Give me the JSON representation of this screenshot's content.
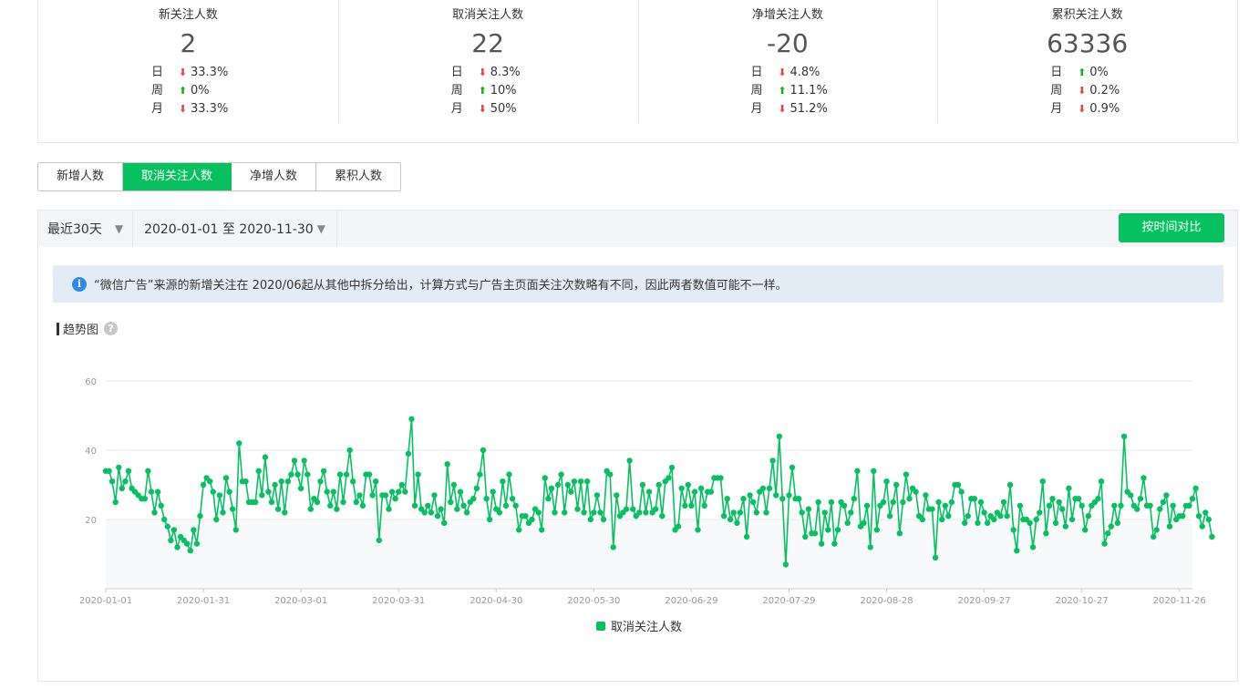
{
  "stats": [
    {
      "title": "新关注人数",
      "value": "2",
      "rows": [
        {
          "label": "日",
          "dir": "down",
          "value": "33.3%"
        },
        {
          "label": "周",
          "dir": "up",
          "value": "0%"
        },
        {
          "label": "月",
          "dir": "down",
          "value": "33.3%"
        }
      ]
    },
    {
      "title": "取消关注人数",
      "value": "22",
      "rows": [
        {
          "label": "日",
          "dir": "down",
          "value": "8.3%"
        },
        {
          "label": "周",
          "dir": "up",
          "value": "10%"
        },
        {
          "label": "月",
          "dir": "down",
          "value": "50%"
        }
      ]
    },
    {
      "title": "净增关注人数",
      "value": "-20",
      "rows": [
        {
          "label": "日",
          "dir": "down",
          "value": "4.8%"
        },
        {
          "label": "周",
          "dir": "up",
          "value": "11.1%"
        },
        {
          "label": "月",
          "dir": "down",
          "value": "51.2%"
        }
      ]
    },
    {
      "title": "累积关注人数",
      "value": "63336",
      "rows": [
        {
          "label": "日",
          "dir": "up",
          "value": "0%"
        },
        {
          "label": "周",
          "dir": "down",
          "value": "0.2%"
        },
        {
          "label": "月",
          "dir": "down",
          "value": "0.9%"
        }
      ]
    }
  ],
  "tabs": [
    {
      "label": "新增人数",
      "active": false
    },
    {
      "label": "取消关注人数",
      "active": true
    },
    {
      "label": "净增人数",
      "active": false
    },
    {
      "label": "累积人数",
      "active": false
    }
  ],
  "toolbar": {
    "range_label": "最近30天",
    "date_range": "2020-01-01 至 2020-11-30",
    "compare_button": "按时间对比"
  },
  "notice": {
    "icon": "info-icon",
    "text": "“微信广告”来源的新增关注在 2020/06起从其他中拆分给出，计算方式与广告主页面关注次数略有不同，因此两者数值可能不一样。"
  },
  "section_title": "趋势图",
  "colors": {
    "accent": "#07c160",
    "up": "#1aad19",
    "down": "#e64340"
  },
  "chart_data": {
    "type": "line",
    "x_start": "2020-01-01",
    "x_end": "2020-11-30",
    "x_ticks": [
      "2020-01-01",
      "2020-01-31",
      "2020-03-01",
      "2020-03-31",
      "2020-04-30",
      "2020-05-30",
      "2020-06-29",
      "2020-07-29",
      "2020-08-28",
      "2020-09-27",
      "2020-10-27",
      "2020-11-26"
    ],
    "y_ticks": [
      20,
      40,
      60
    ],
    "ylim": [
      0,
      60
    ],
    "grid": true,
    "legend": "bottom-center",
    "series": [
      {
        "name": "取消关注人数",
        "color": "#07c160",
        "values": [
          34,
          34,
          31,
          25,
          35,
          29,
          31,
          34,
          29,
          28,
          27,
          26,
          26,
          34,
          28,
          22,
          28,
          24,
          20,
          18,
          14,
          17,
          12,
          15,
          14,
          13,
          11,
          17,
          13,
          21,
          30,
          32,
          31,
          28,
          20,
          27,
          22,
          32,
          28,
          23,
          17,
          42,
          31,
          31,
          25,
          25,
          25,
          34,
          27,
          38,
          28,
          25,
          30,
          23,
          31,
          22,
          31,
          33,
          37,
          33,
          29,
          37,
          33,
          23,
          26,
          25,
          31,
          34,
          28,
          24,
          28,
          23,
          33,
          25,
          33,
          40,
          31,
          25,
          27,
          24,
          33,
          33,
          27,
          31,
          14,
          27,
          27,
          23,
          28,
          26,
          28,
          30,
          28,
          39,
          49,
          24,
          33,
          23,
          22,
          24,
          22,
          27,
          21,
          23,
          19,
          36,
          25,
          30,
          23,
          28,
          24,
          22,
          25,
          26,
          29,
          33,
          40,
          26,
          20,
          28,
          23,
          22,
          31,
          24,
          33,
          26,
          24,
          17,
          21,
          21,
          19,
          20,
          23,
          22,
          17,
          32,
          26,
          29,
          22,
          30,
          33,
          22,
          30,
          28,
          31,
          23,
          31,
          22,
          31,
          20,
          22,
          27,
          22,
          20,
          34,
          33,
          12,
          27,
          21,
          22,
          23,
          37,
          23,
          21,
          22,
          30,
          22,
          28,
          22,
          23,
          30,
          21,
          31,
          32,
          35,
          17,
          18,
          29,
          24,
          30,
          24,
          28,
          17,
          29,
          24,
          28,
          28,
          32,
          32,
          32,
          21,
          26,
          20,
          22,
          19,
          22,
          26,
          15,
          27,
          25,
          22,
          28,
          29,
          22,
          29,
          37,
          27,
          44,
          26,
          7,
          27,
          35,
          26,
          26,
          22,
          15,
          23,
          16,
          16,
          25,
          13,
          22,
          17,
          25,
          13,
          17,
          25,
          24,
          19,
          22,
          26,
          34,
          18,
          19,
          24,
          12,
          34,
          17,
          24,
          25,
          31,
          21,
          25,
          30,
          16,
          25,
          33,
          26,
          29,
          28,
          21,
          20,
          27,
          23,
          23,
          9,
          25,
          20,
          24,
          21,
          25,
          30,
          30,
          28,
          19,
          21,
          26,
          26,
          19,
          25,
          22,
          19,
          21,
          20,
          22,
          21,
          25,
          21,
          30,
          17,
          11,
          24,
          20,
          20,
          19,
          12,
          20,
          22,
          31,
          16,
          24,
          26,
          19,
          25,
          23,
          18,
          29,
          20,
          26,
          26,
          24,
          17,
          21,
          24,
          25,
          26,
          31,
          13,
          16,
          18,
          24,
          19,
          24,
          44,
          28,
          27,
          24,
          23,
          26,
          32,
          24,
          24,
          15,
          17,
          23,
          25,
          27,
          18,
          24,
          20,
          21,
          21,
          24,
          24,
          26,
          29,
          21,
          18,
          22,
          20,
          15
        ]
      }
    ]
  }
}
